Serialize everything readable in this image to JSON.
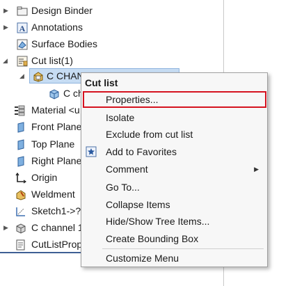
{
  "tree": {
    "items": [
      {
        "label": "Design Binder",
        "icon": "folder-icon"
      },
      {
        "label": "Annotations",
        "icon": "annotations-icon"
      },
      {
        "label": "Surface Bodies",
        "icon": "surface-bodies-icon"
      },
      {
        "label": "Cut list(1)",
        "icon": "cut-list-icon"
      },
      {
        "label": "C CHAN",
        "icon": "cut-list-item-icon"
      },
      {
        "label": "C ch",
        "icon": "solid-body-icon"
      },
      {
        "label": "Material <u",
        "icon": "material-icon"
      },
      {
        "label": "Front Plane",
        "icon": "plane-icon"
      },
      {
        "label": "Top Plane",
        "icon": "plane-icon"
      },
      {
        "label": "Right Plane",
        "icon": "plane-icon"
      },
      {
        "label": "Origin",
        "icon": "origin-icon"
      },
      {
        "label": "Weldment",
        "icon": "weldment-icon"
      },
      {
        "label": "Sketch1->?",
        "icon": "sketch-icon"
      },
      {
        "label": "C channel 1",
        "icon": "structural-member-icon"
      },
      {
        "label": "CutListProp",
        "icon": "cut-list-properties-icon"
      }
    ]
  },
  "context_menu": {
    "title": "Cut list",
    "items": {
      "properties": "Properties...",
      "isolate": "Isolate",
      "exclude": "Exclude from cut list",
      "favorites": "Add to Favorites",
      "comment": "Comment",
      "goto": "Go To...",
      "collapse": "Collapse Items",
      "hide_show": "Hide/Show Tree Items...",
      "bounding_box": "Create Bounding Box",
      "customize": "Customize Menu"
    },
    "highlight_color": "#d5121f"
  }
}
